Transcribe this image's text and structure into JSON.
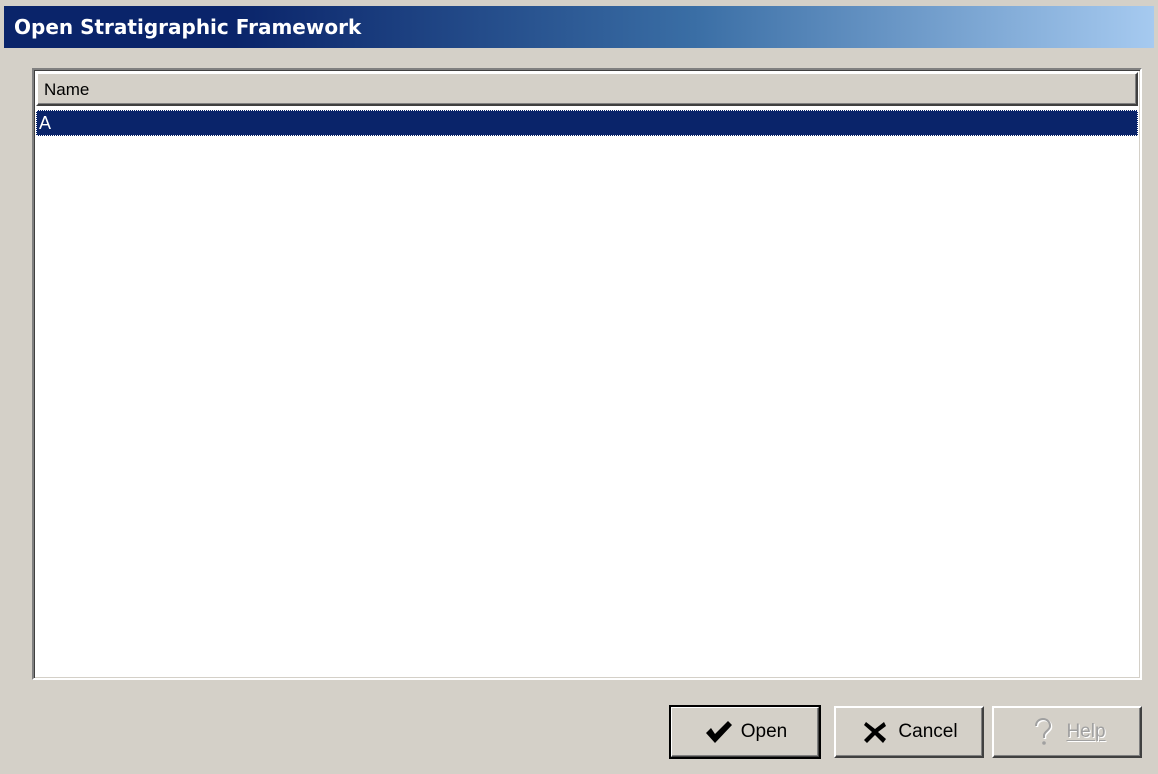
{
  "window": {
    "title": "Open Stratigraphic Framework"
  },
  "list": {
    "columns": [
      "Name"
    ],
    "rows": [
      {
        "name": "A",
        "selected": true
      }
    ]
  },
  "buttons": {
    "open": {
      "label": "Open",
      "icon": "check-icon",
      "enabled": true,
      "default": true
    },
    "cancel": {
      "label": "Cancel",
      "icon": "x-icon",
      "enabled": true
    },
    "help": {
      "label": "Help",
      "icon": "question-icon",
      "enabled": false
    }
  },
  "colors": {
    "selection": "#0a246a",
    "face": "#d4d0c8"
  }
}
